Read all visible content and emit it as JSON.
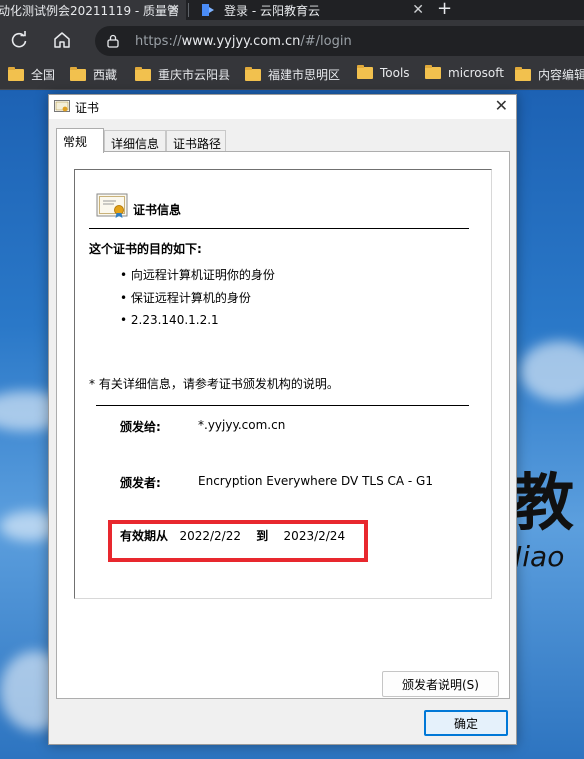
{
  "browser": {
    "tabs": [
      {
        "title": "动化测试例会20211119 - 质量管",
        "active": true
      },
      {
        "title": "登录 - 云阳教育云",
        "active": false
      }
    ],
    "close_glyph": "✕",
    "new_tab_glyph": "+",
    "url_prefix": "https://",
    "url_host": "www.yyjyy.com.cn",
    "url_path": "/#/login",
    "bookmarks": [
      "全国",
      "西藏",
      "重庆市云阳县",
      "福建市思明区",
      "Tools",
      "microsoft",
      "内容编辑"
    ]
  },
  "background": {
    "big_char": "教",
    "small_text": "Jiao"
  },
  "dialog": {
    "title": "证书",
    "tabs": [
      "常规",
      "详细信息",
      "证书路径"
    ],
    "heading": "证书信息",
    "purpose_title": "这个证书的目的如下:",
    "purposes": [
      "• 向远程计算机证明你的身份",
      "• 保证远程计算机的身份",
      "• 2.23.140.1.2.1"
    ],
    "note": "* 有关详细信息，请参考证书颁发机构的说明。",
    "issued_to_label": "颁发给:",
    "issued_to_value": "*.yyjyy.com.cn",
    "issued_by_label": "颁发者:",
    "issued_by_value": "Encryption Everywhere DV TLS CA - G1",
    "valid_from_label": "有效期从",
    "valid_from": "2022/2/22",
    "valid_to_label": "到",
    "valid_to": "2023/2/24",
    "issuer_statement_button": "颁发者说明(S)",
    "ok_button": "确定"
  }
}
